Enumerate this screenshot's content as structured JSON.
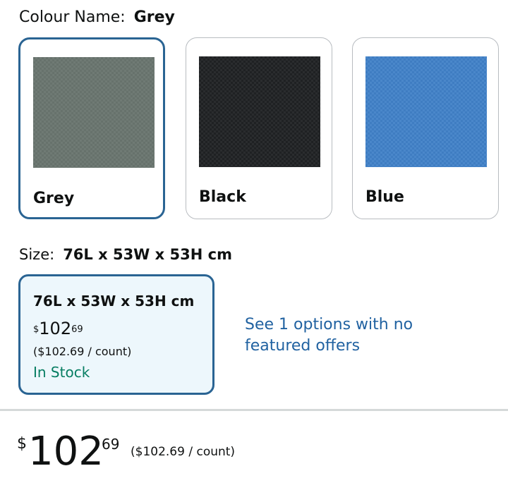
{
  "colour": {
    "label": "Colour Name:",
    "selected": "Grey",
    "options": [
      {
        "name": "Grey",
        "color": "#6f7a74",
        "selected": true
      },
      {
        "name": "Black",
        "color": "#1f2123",
        "selected": false
      },
      {
        "name": "Blue",
        "color": "#3f7dc2",
        "selected": false
      }
    ]
  },
  "size": {
    "label": "Size:",
    "selected": "76L x 53W x 53H cm",
    "card": {
      "title": "76L x 53W x 53H cm",
      "price_symbol": "$",
      "price_whole": "102",
      "price_fraction": "69",
      "unit_price": "($102.69 / count)",
      "stock": "In Stock"
    },
    "other_options_link": "See 1 options with no featured offers"
  },
  "price_bar": {
    "symbol": "$",
    "whole": "102",
    "fraction": "69",
    "unit_price": "($102.69 / count)"
  },
  "colors": {
    "selected_border": "#2a6493",
    "selected_bg": "#edf7fc",
    "link": "#2162a1",
    "in_stock": "#067d62"
  }
}
